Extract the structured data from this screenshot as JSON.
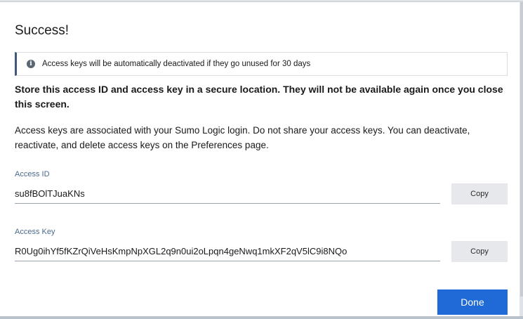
{
  "dialog": {
    "title": "Success!",
    "banner": {
      "icon": "info-icon",
      "text": "Access keys will be automatically deactivated if they go unused for 30 days"
    },
    "warning": "Store this access ID and access key in a secure location. They will not be available again once you close this screen.",
    "description": "Access keys are associated with your Sumo Logic login. Do not share your access keys. You can deactivate, reactivate, and delete access keys on the Preferences page.",
    "access_id": {
      "label": "Access ID",
      "value": "su8fBOlTJuaKNs",
      "copy_label": "Copy"
    },
    "access_key": {
      "label": "Access Key",
      "value": "R0Ug0ihYf5fKZrQiVeHsKmpNpXGL2q9n0ui2oLpqn4geNwq1mkXF2qV5lC9i8NQo",
      "copy_label": "Copy"
    },
    "done_label": "Done"
  },
  "colors": {
    "primary": "#1f6ad6",
    "banner_accent": "#3f5a76",
    "label": "#4a6a8a"
  }
}
